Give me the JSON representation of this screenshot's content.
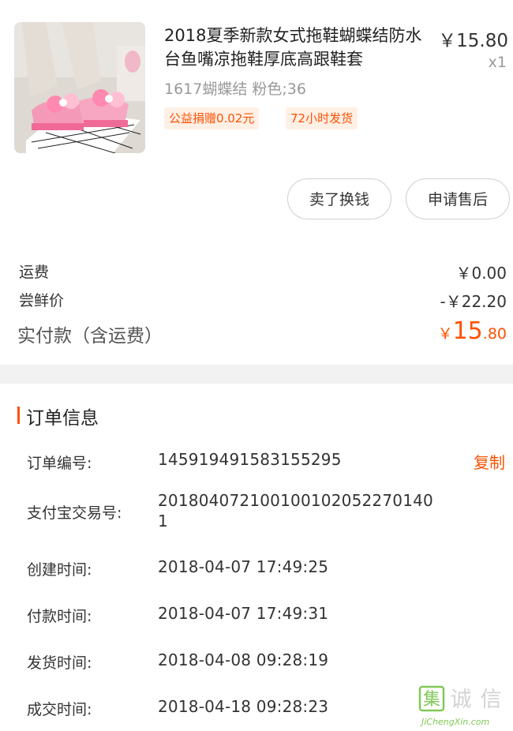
{
  "product": {
    "title": "2018夏季新款女式拖鞋蝴蝶结防水台鱼嘴凉拖鞋厚底高跟鞋套",
    "price": "￥15.80",
    "quantity": "x1",
    "sku": "1617蝴蝶结 粉色;36",
    "image_icon": "product-photo",
    "tags": [
      "公益捐赠0.02元",
      "72小时发货"
    ]
  },
  "actions": {
    "sell_label": "卖了换钱",
    "after_sale_label": "申请售后"
  },
  "fees": {
    "shipping_label": "运费",
    "shipping_value": "￥0.00",
    "trial_label": "尝鲜价",
    "trial_value": "-￥22.20",
    "total_label": "实付款（含运费）",
    "total_currency": "￥",
    "total_integer": "15",
    "total_decimal": ".80"
  },
  "order_info": {
    "title": "订单信息",
    "copy_label": "复制",
    "rows": [
      {
        "label": "订单编号:",
        "value": "145919491583155295"
      },
      {
        "label": "支付宝交易号:",
        "value": "2018040721001001020522701401"
      },
      {
        "label": "创建时间:",
        "value": "2018-04-07 17:49:25"
      },
      {
        "label": "付款时间:",
        "value": "2018-04-07 17:49:31"
      },
      {
        "label": "发货时间:",
        "value": "2018-04-08 09:28:19"
      },
      {
        "label": "成交时间:",
        "value": "2018-04-18 09:28:23"
      }
    ]
  },
  "watermark": {
    "brand_chars": [
      "集",
      "诚",
      "信"
    ],
    "url_text": "JiChengXin.com"
  },
  "colors": {
    "accent": "#ff5000",
    "tag_bg": "#fff0e6",
    "muted": "#999999",
    "divider": "#f2f2f2"
  }
}
